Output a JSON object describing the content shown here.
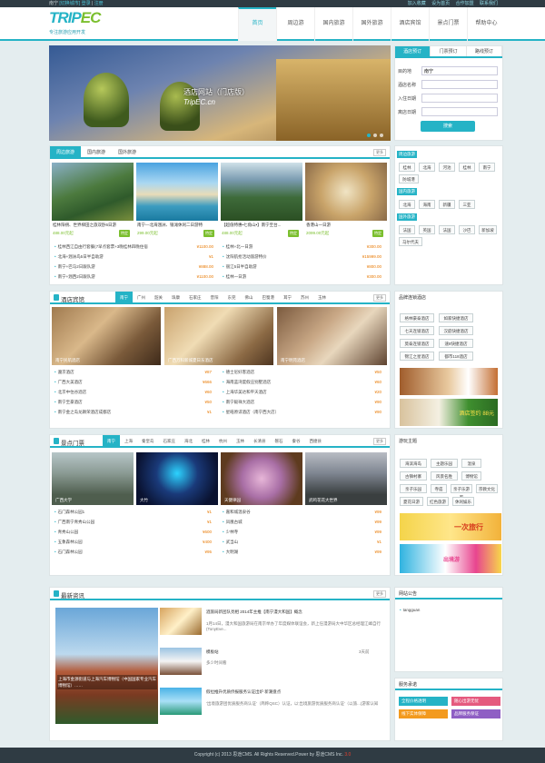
{
  "topbar": {
    "city": "南宁",
    "switch": "[切换城市]",
    "login": "登录",
    "sep": "|",
    "register": "注册",
    "right_links": [
      "加入收藏",
      "设为首页",
      "合作加盟",
      "联系我们"
    ]
  },
  "logo": {
    "main": "TRIP",
    "accent": "EC",
    "slogan": "专注旅游应用开发"
  },
  "nav": [
    "首页",
    "周边游",
    "国内旅游",
    "国外旅游",
    "酒店宾馆",
    "景点门票",
    "帮助中心"
  ],
  "banner": {
    "title": "酒店网站（门店版）",
    "subtitle": "TripEC.cn"
  },
  "booking": {
    "tabs": [
      "酒店预订",
      "门票预订",
      "路线预订"
    ],
    "fields": [
      {
        "label": "目的地",
        "value": "南宁"
      },
      {
        "label": "酒店名称",
        "value": ""
      },
      {
        "label": "入住日期",
        "value": ""
      },
      {
        "label": "离店日期",
        "value": ""
      }
    ],
    "search": "搜索"
  },
  "tours": {
    "tabs": [
      "周边旅游",
      "国内旅游",
      "国外旅游"
    ],
    "more": "更多",
    "cards": [
      {
        "title": "桂林阳朔、世界梯田之旅双卧6日游",
        "price": "488.00元起",
        "tag": "特定"
      },
      {
        "title": "南宁—北海涠洲、银滩休闲二日游特",
        "price": "299.00元起",
        "tag": "特定"
      },
      {
        "title": "【超值特惠•七角山•】南宁至台...",
        "price": "488.00元起",
        "tag": "特定"
      },
      {
        "title": "香港山一日游",
        "price": "2099.00元起",
        "tag": "特定"
      }
    ],
    "list_left": [
      {
        "name": "桂林西江自由行套餐(7早点套票+3晚桂林四晚住宿",
        "price": "¥1100.00"
      },
      {
        "name": "北海+涠洲岛5日半自助游",
        "price": "¥1"
      },
      {
        "name": "南宁+巴马2日跟队游",
        "price": "¥888.00"
      },
      {
        "name": "南宁+涠西2日跟队游",
        "price": "¥1100.00"
      }
    ],
    "list_right": [
      {
        "name": "桂林+北一日游",
        "price": "¥300.00"
      },
      {
        "name": "沈阳航抢活动旅游特价",
        "price": "¥15999.00"
      },
      {
        "name": "丽江5日半自助游",
        "price": "¥800.00"
      },
      {
        "name": "桂林一日游",
        "price": "¥300.00"
      }
    ]
  },
  "side_dest": {
    "groups": [
      {
        "label": "周边旅游",
        "items": [
          "桂林",
          "北海",
          "河池",
          "桂林",
          "南宁",
          "防城港"
        ]
      },
      {
        "label": "国内旅游",
        "items": [
          "北海",
          "海南",
          "新疆",
          "三亚"
        ]
      },
      {
        "label": "国外旅游",
        "items": [
          "法国",
          "英国",
          "法国",
          "沙巴",
          "新加坡",
          "马尔代夫"
        ]
      }
    ]
  },
  "hotels": {
    "title": "酒店宾馆",
    "more": "更多",
    "cities": [
      "南宁",
      "广州",
      "韶关",
      "珠康",
      "石家庄",
      "昔阳",
      "东莞",
      "佛山",
      "巴蜀港",
      "耳宁",
      "苏州",
      "玉林"
    ],
    "photos": [
      "南宁民航酒店",
      "广西万科新城夏日东酒店",
      "南宁明苑酒店"
    ],
    "list_left": [
      {
        "name": "遵京酒店",
        "price": "¥87"
      },
      {
        "name": "广西大美酒店",
        "price": "¥666"
      },
      {
        "name": "北京中住谷酒店",
        "price": "¥60"
      },
      {
        "name": "南宁至豪酒店",
        "price": "¥50"
      },
      {
        "name": "南宁金之岛龙颖荣酒店成都店",
        "price": "¥1"
      }
    ],
    "list_right": [
      {
        "name": "德士尼好客酒店",
        "price": "¥50"
      },
      {
        "name": "海南蓝湾度假庄别墅酒店",
        "price": "¥60"
      },
      {
        "name": "上海华美达和平天酒店",
        "price": "¥20"
      },
      {
        "name": "南宁毅祥大酒店",
        "price": "¥90"
      },
      {
        "name": "星皓原谅酒店（南宁西大店）",
        "price": "¥90"
      }
    ]
  },
  "side_brand": {
    "title": "品牌连锁酒店",
    "chips": [
      "格林豪泰酒店",
      "如家快捷酒店",
      "七天连锁酒店",
      "汉庭快捷酒店",
      "莫泰连锁酒店",
      "速8快捷酒店",
      "锦江之星酒店",
      "都市118酒店"
    ],
    "ad2": "酒店签约 88元"
  },
  "scenic": {
    "title": "景点门票",
    "more": "更多",
    "cities": [
      "南宁",
      "上海",
      "秦皇岛",
      "石家庄",
      "海北",
      "桂林",
      "杭州",
      "玉林",
      "长清县",
      "磐石",
      "秦谷",
      "西捷县"
    ],
    "photos": [
      "广西大学",
      "大竹",
      "天健律园",
      "武鸣花花大世界"
    ],
    "list_left": [
      {
        "name": "石门森林公园1",
        "price": "¥1"
      },
      {
        "name": "广西南宁青秀山公园",
        "price": "¥1"
      },
      {
        "name": "青秀山公园",
        "price": "¥600"
      },
      {
        "name": "五象森林公园",
        "price": "¥400"
      },
      {
        "name": "石门森林公园",
        "price": "¥95"
      }
    ],
    "list_right": [
      {
        "name": "嘉和城温泉谷",
        "price": "¥99"
      },
      {
        "name": "凤凰古城",
        "price": "¥99"
      },
      {
        "name": "少林寺",
        "price": "¥99"
      },
      {
        "name": "武当山",
        "price": "¥1"
      },
      {
        "name": "大明湖",
        "price": "¥99"
      }
    ]
  },
  "side_theme": {
    "title": "游玩主题",
    "chips": [
      "海滨海岛",
      "主题乐园",
      "温泉",
      "古镇村寨",
      "风景名胜",
      "博物馆",
      "亲子乐园",
      "寺庙",
      "亲子乐游家",
      "宗教文化",
      "夏花日游",
      "红色旅游",
      "休闲娱乐"
    ],
    "ad1": "一次旅行",
    "ad2": "出境游"
  },
  "news": {
    "title": "最新资讯",
    "more": "更多",
    "main_caption": "上海市金源街道与上海汽车博物馆（中国国家专业汽车博物馆）……",
    "items": [
      {
        "title": "酒旅局新团队亮相 2014年主推【南宁漫大和国】概念",
        "date": "",
        "summary": "1月14日，漫大和国旅游局在南京举办了年度媒体联谊会，新上任漫游局大中华区总经理江峰自行(TonyEve..."
      },
      {
        "title": "模板站",
        "date": "3天前",
        "summary": "多少时间看"
      },
      {
        "title": "假拉推升优质侨报服务认证出炉 新潮盘点",
        "date": "",
        "summary": "'出境旅游团优质服务商认证'（简称QSC）认证，以'出境旅游优质服务商认证'（以旅...(游家认知"
      }
    ]
  },
  "notice": {
    "title": "网站公告",
    "items": [
      "tangguan"
    ]
  },
  "services": {
    "title": "服务承诺",
    "items": [
      {
        "label": "全程价格透明",
        "color": "#25b3c6"
      },
      {
        "label": "随心出游无忧",
        "color": "#e55a7e"
      },
      {
        "label": "线下实体保障",
        "color": "#f39a1e"
      },
      {
        "label": "品牌服务保证",
        "color": "#8f5fc4"
      }
    ]
  },
  "footer": {
    "text": "Copyright (c) 2013 思途CMS. All Rights Reserved.Power by 思途CMS Inc.",
    "version": "3.0"
  }
}
